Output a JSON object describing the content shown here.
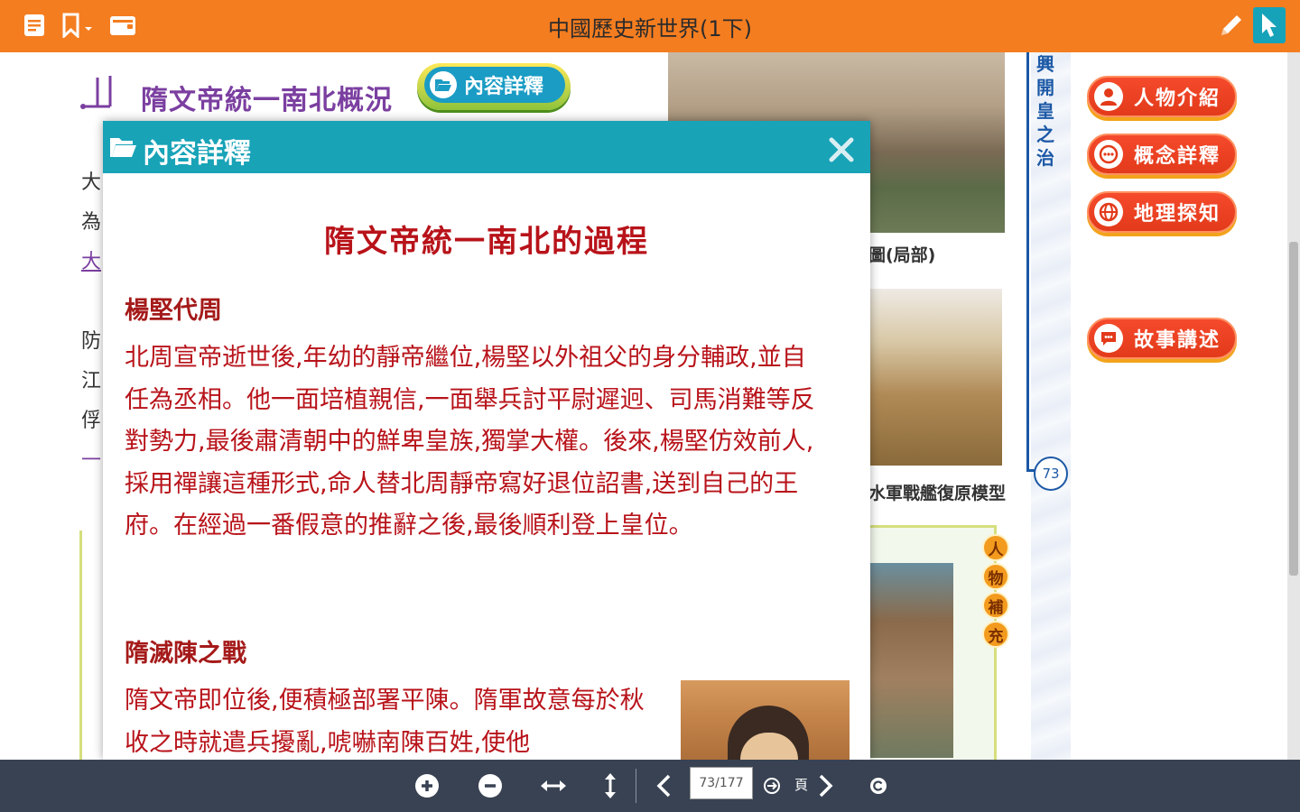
{
  "header": {
    "title": "中國歷史新世界(1下)",
    "left_icons": [
      "book-icon",
      "bookmark-icon",
      "folder-icon"
    ],
    "right_icons": [
      "pencil-icon",
      "pointer-icon"
    ],
    "bar_color": "#f47d20"
  },
  "page": {
    "section_title": "隋文帝統一南北概況",
    "detail_button_label": "內容詳釋",
    "left_chars_1": [
      "大",
      "為",
      "大"
    ],
    "left_chars_2": [
      "防",
      "江",
      "俘",
      "一"
    ],
    "caption_1": "圖(局部)",
    "caption_2": "水軍戰艦復原模型",
    "supplement_chars": [
      "人",
      "物",
      "補",
      "充"
    ],
    "vertical_text": "興開皇之治",
    "page_number": "73",
    "side_buttons": [
      {
        "label": "人物介紹",
        "icon": "person-icon"
      },
      {
        "label": "概念詳釋",
        "icon": "chat-icon"
      },
      {
        "label": "地理探知",
        "icon": "globe-icon"
      },
      {
        "label": "故事講述",
        "icon": "speech-icon"
      }
    ]
  },
  "modal": {
    "title": "內容詳釋",
    "heading": "隋文帝統一南北的過程",
    "section1_title": "楊堅代周",
    "section1_text": "北周宣帝逝世後,年幼的靜帝繼位,楊堅以外祖父的身分輔政,並自任為丞相。他一面培植親信,一面舉兵討平尉遲迥、司馬消難等反對勢力,最後肅清朝中的鮮卑皇族,獨掌大權。後來,楊堅仿效前人,採用禪讓這種形式,命人替北周靜帝寫好退位詔書,送到自己的王府。在經過一番假意的推辭之後,最後順利登上皇位。",
    "section2_title": "隋滅陳之戰",
    "section2_text": "隋文帝即位後,便積極部署平陳。隋軍故意每於秋收之時就遣兵擾亂,唬嚇南陳百姓,使他",
    "accent_color": "#18a3b7",
    "text_color": "#b8131a"
  },
  "toolbar": {
    "page_value": "73/177",
    "page_label": "頁",
    "icons": [
      "zoom-in-icon",
      "zoom-out-icon",
      "fit-width-icon",
      "fit-height-icon",
      "prev-page-icon",
      "go-icon",
      "next-page-icon",
      "refresh-icon"
    ]
  }
}
